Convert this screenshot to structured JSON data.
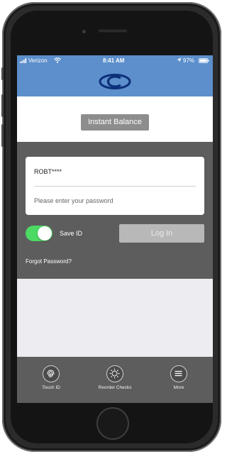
{
  "status_bar": {
    "carrier": "Verizon",
    "time": "8:41 AM",
    "battery": "97%"
  },
  "header": {
    "logo_icon": "bank-logo-icon"
  },
  "instant_balance": {
    "label": "Instant Balance"
  },
  "login": {
    "username": "ROBT****",
    "password_placeholder": "Please enter your password",
    "save_id_label": "Save ID",
    "save_id_checked": true,
    "login_label": "Log In",
    "forgot_password": "Forgot Password?"
  },
  "tabs": [
    {
      "label": "Touch ID",
      "icon": "fingerprint-icon"
    },
    {
      "label": "Reorder Checks",
      "icon": "checks-icon"
    },
    {
      "label": "More",
      "icon": "menu-icon"
    }
  ],
  "colors": {
    "header": "#5c8fcb",
    "panel": "#5d5d5d",
    "toggle_on": "#4cd964",
    "button_gray": "#8d8d8d"
  }
}
